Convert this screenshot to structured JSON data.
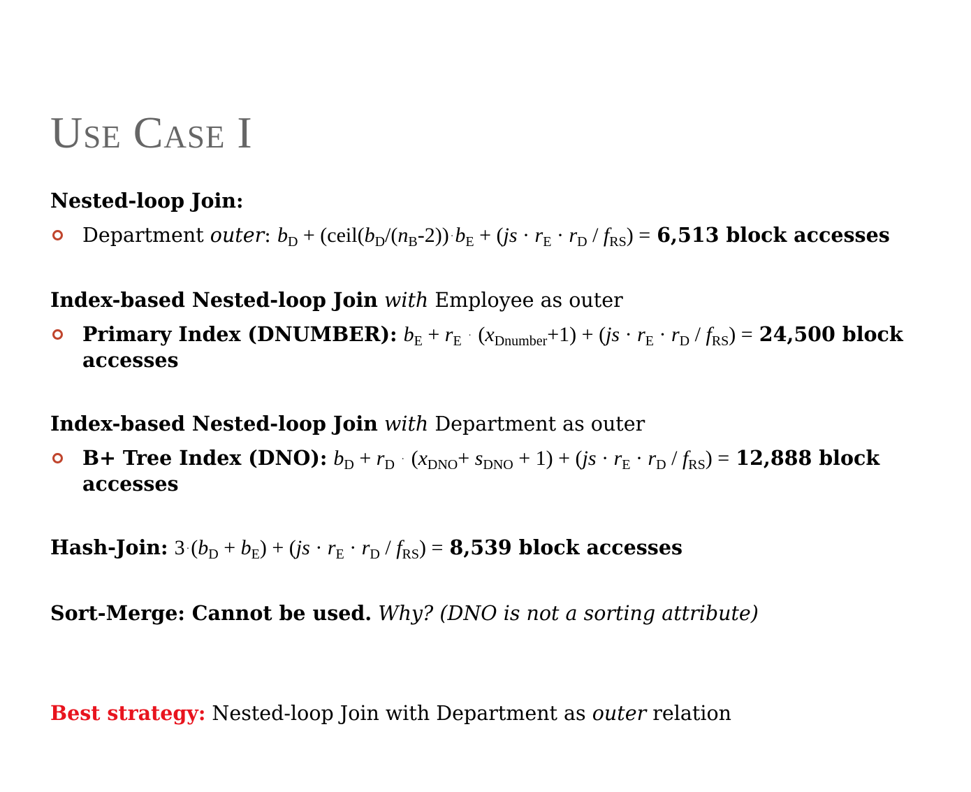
{
  "slide": {
    "title": "Use Case I",
    "s1_heading": "Nested-loop Join:",
    "s1_item_name": "Department",
    "s1_item_outer": "outer",
    "s1_item_colon": ":",
    "s1_result": "6,513 block accesses",
    "s2_heading": "Index-based Nested-loop Join",
    "s2_with": "with",
    "s2_rest": "Employee as outer",
    "s2_item_label": "Primary Index (DNUMBER):",
    "s2_result": "24,500 block accesses",
    "s3_heading": "Index-based Nested-loop Join",
    "s3_with": "with",
    "s3_rest": "Department as outer",
    "s3_item_label": "B+ Tree Index (DNO):",
    "s3_result": "12,888 block accesses",
    "s4_label": "Hash-Join:",
    "s4_result": "8,539 block accesses",
    "s5_label": "Sort-Merge: Cannot be used.",
    "s5_why": "Why? (DNO is not a sorting attribute)",
    "best_label": "Best strategy:",
    "best_text1": "Nested-loop Join with Department as",
    "best_outer": "outer",
    "best_text2": "relation",
    "colors": {
      "title": "#666666",
      "bullet": "#c0452d",
      "highlight": "#e8141e"
    }
  }
}
